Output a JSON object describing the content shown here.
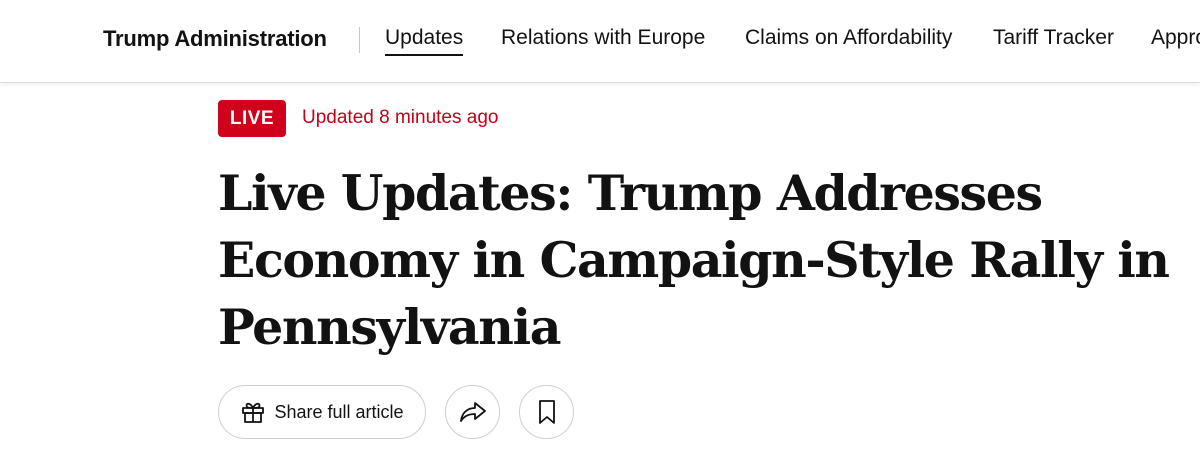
{
  "nav": {
    "section_title": "Trump Administration",
    "links": [
      {
        "label": "Updates",
        "active": true
      },
      {
        "label": "Relations with Europe",
        "active": false
      },
      {
        "label": "Claims on Affordability",
        "active": false
      },
      {
        "label": "Tariff Tracker",
        "active": false
      },
      {
        "label": "Appro",
        "active": false
      }
    ]
  },
  "status": {
    "live_label": "LIVE",
    "updated_text": "Updated 8 minutes ago",
    "live_color": "#d0021b"
  },
  "headline": "Live Updates: Trump Addresses Economy in Campaign-Style Rally in Pennsylvania",
  "actions": {
    "share_label": "Share full article",
    "share_icon": "gift-icon",
    "forward_icon": "share-arrow-icon",
    "save_icon": "bookmark-icon"
  }
}
